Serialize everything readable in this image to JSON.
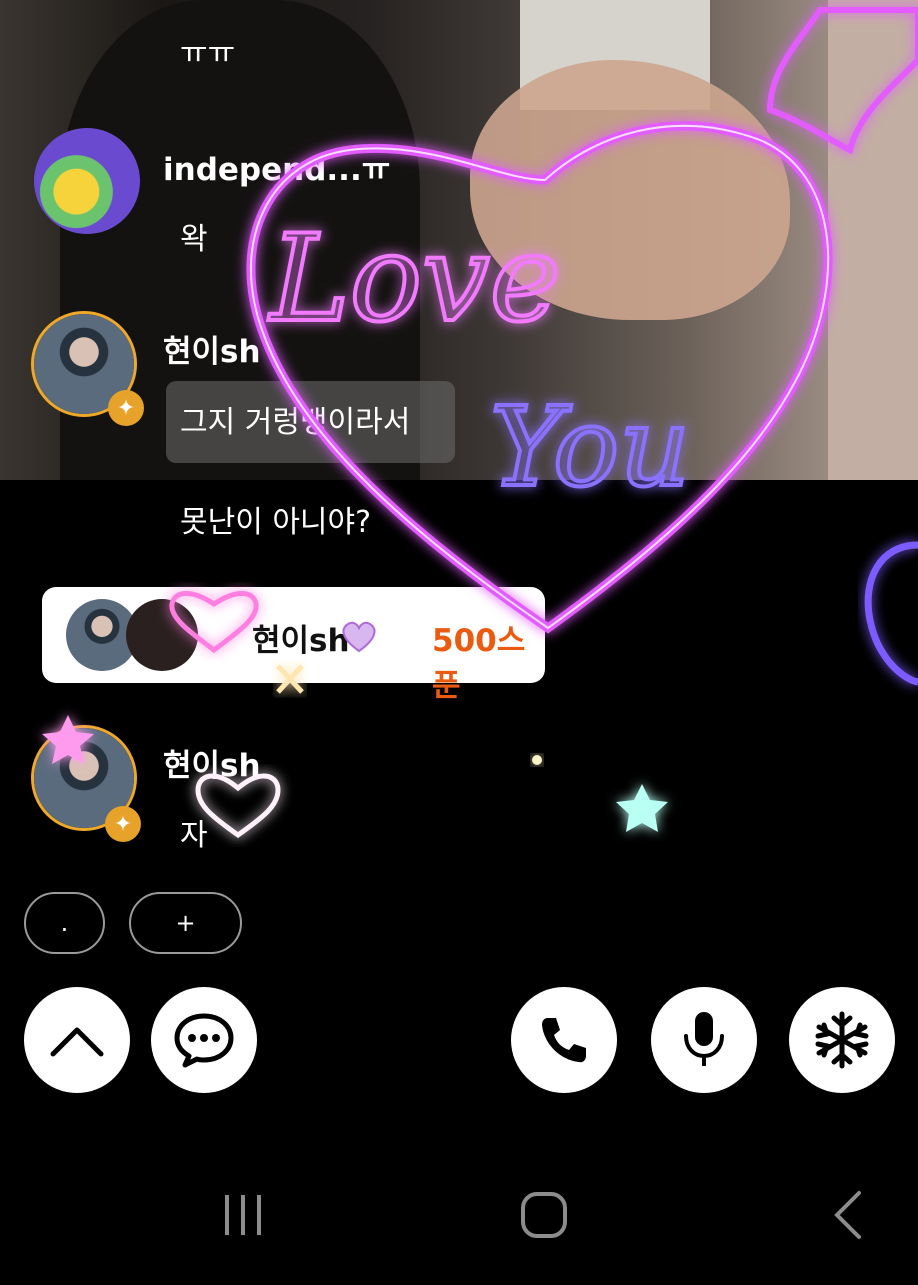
{
  "chat": {
    "messages": [
      {
        "text": "ㅠㅠ"
      },
      {
        "user": "independ...ㅠ",
        "text": "왁"
      },
      {
        "user": "현이sh",
        "text": "그지 거렁뱅이라서"
      },
      {
        "text": "못난이 아니야?"
      },
      {
        "user": "현이sh",
        "text": "자"
      }
    ]
  },
  "gift": {
    "user": "현이sh",
    "amount": "500스푼"
  },
  "quick_chat": {
    "dot": ".",
    "plus": "+"
  },
  "effects": {
    "love_text": "Love",
    "you_text": "You"
  },
  "icons": {
    "up": "chevron-up-icon",
    "chat": "chat-bubble-icon",
    "call": "phone-icon",
    "mic": "microphone-icon",
    "freeze": "snowflake-icon",
    "recent": "recent-apps-icon",
    "home": "home-icon",
    "back": "back-icon"
  },
  "colors": {
    "gift_amount": "#ea5a10",
    "avatar_ring": "#f0a827",
    "neon": "#d94bff"
  }
}
